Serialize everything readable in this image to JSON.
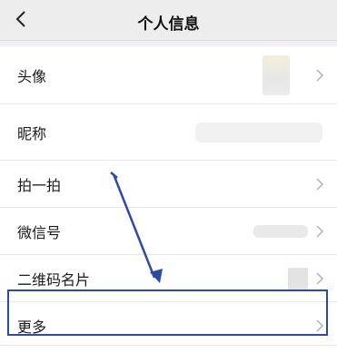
{
  "header": {
    "title": "个人信息",
    "back_icon": "chevron-left-icon"
  },
  "rows": [
    {
      "label": "头像"
    },
    {
      "label": "昵称"
    },
    {
      "label": "拍一拍"
    },
    {
      "label": "微信号"
    },
    {
      "label": "二维码名片"
    },
    {
      "label": "更多"
    }
  ],
  "colors": {
    "background": "#efeff4",
    "annotation": "#2e4aa8"
  }
}
